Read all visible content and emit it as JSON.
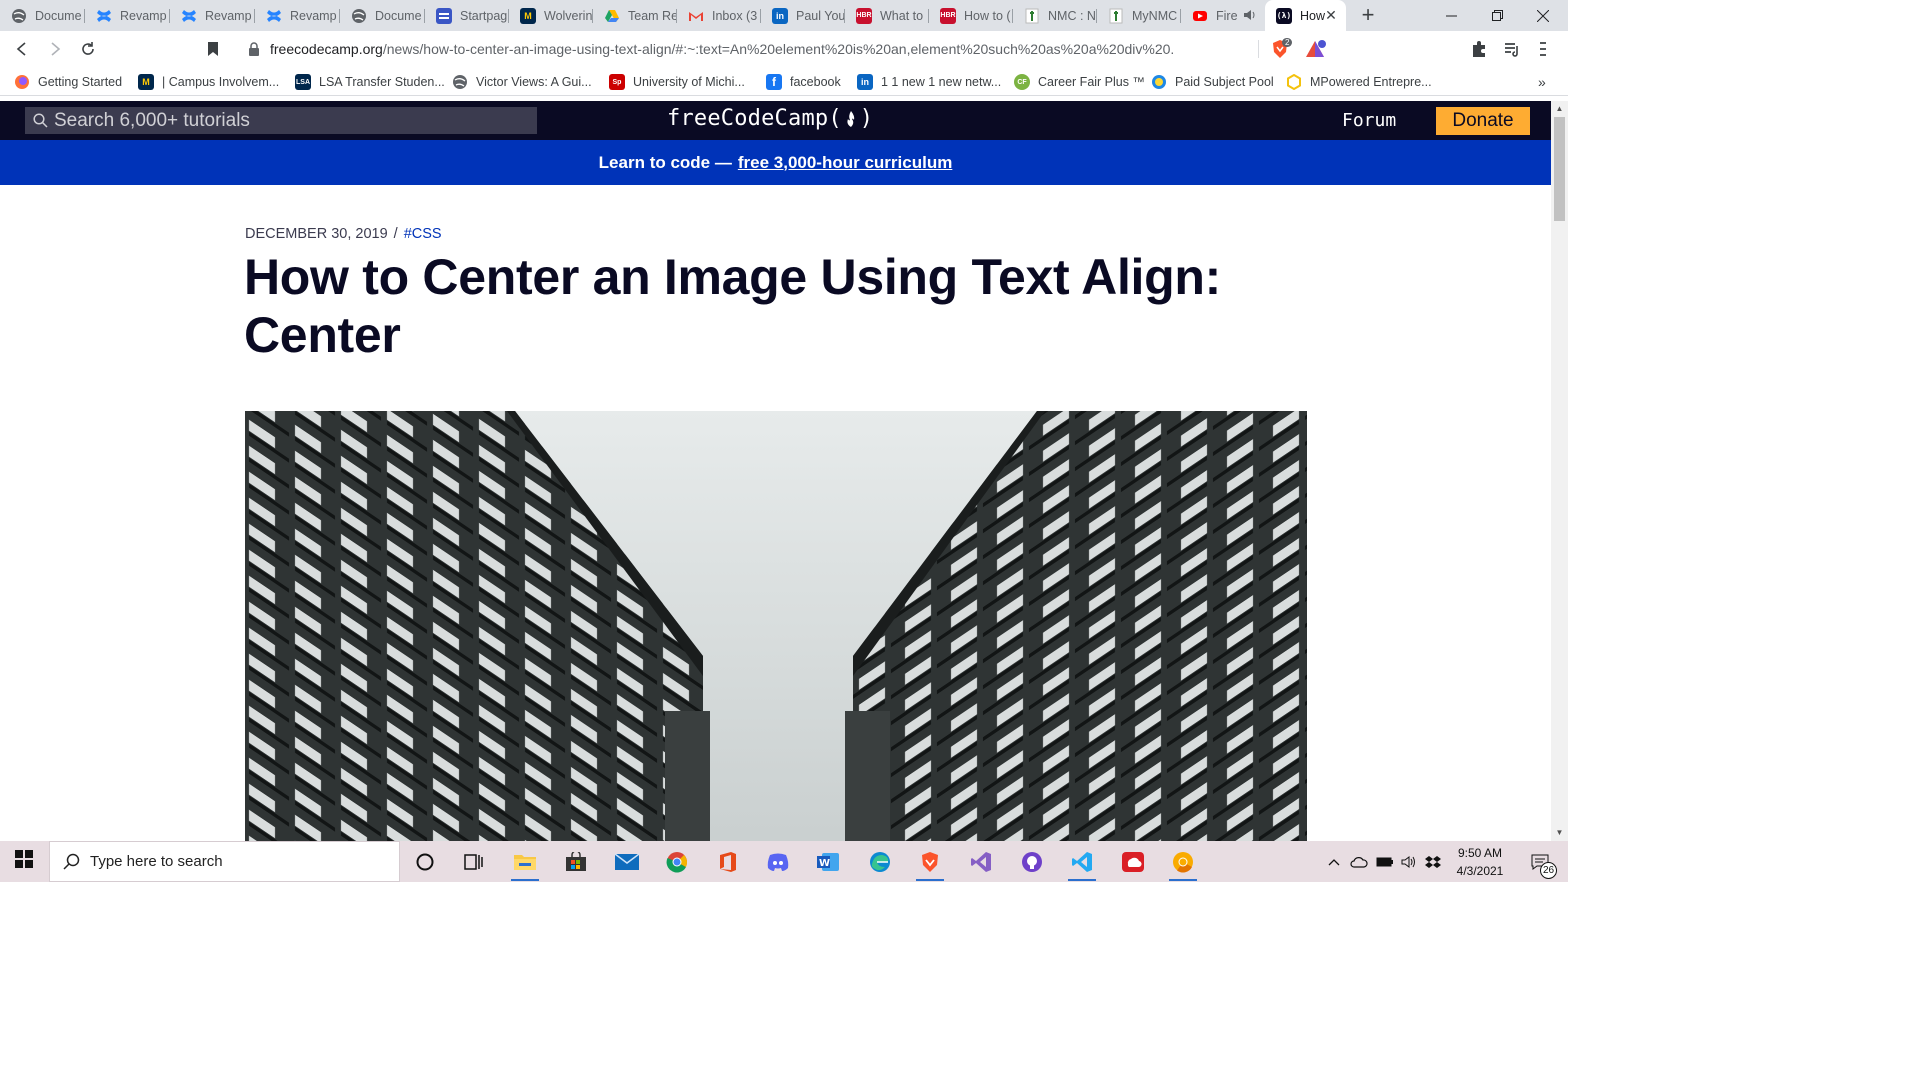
{
  "browser": {
    "tabs": [
      {
        "title": "Docume",
        "icon": "globe-icon",
        "color": "#5f6368"
      },
      {
        "title": "Revamp",
        "icon": "confluence-icon",
        "color": "#2684ff"
      },
      {
        "title": "Revamp",
        "icon": "confluence-icon",
        "color": "#2684ff"
      },
      {
        "title": "Revamp",
        "icon": "confluence-icon",
        "color": "#2684ff"
      },
      {
        "title": "Docume",
        "icon": "globe-icon",
        "color": "#5f6368"
      },
      {
        "title": "Startpag",
        "icon": "startpage-icon",
        "color": "#3a56c5"
      },
      {
        "title": "Wolverin",
        "icon": "umich-icon",
        "color": "#00274c"
      },
      {
        "title": "Team Re",
        "icon": "google-drive-icon",
        "color": "#1fa463"
      },
      {
        "title": "Inbox (3",
        "icon": "gmail-icon",
        "color": "#ea4335"
      },
      {
        "title": "Paul You",
        "icon": "linkedin-icon",
        "color": "#0a66c2"
      },
      {
        "title": "What to",
        "icon": "hbr-icon",
        "color": "#c8102e"
      },
      {
        "title": "How to (",
        "icon": "hbr-icon",
        "color": "#c8102e"
      },
      {
        "title": "NMC : N",
        "icon": "nmc-icon",
        "color": "#2e7d32"
      },
      {
        "title": "MyNMC",
        "icon": "nmc-icon",
        "color": "#2e7d32"
      },
      {
        "title": "Fire",
        "icon": "youtube-icon",
        "color": "#ff0000"
      },
      {
        "title": "How",
        "icon": "freecodecamp-icon",
        "color": "#0a0a23"
      }
    ],
    "active_tab_close": "✕",
    "url_host": "freecodecamp.org",
    "url_path": "/news/how-to-center-an-image-using-text-align/#:~:text=An%20element%20is%20an,element%20such%20as%20a%20div%20.",
    "brave_badge": "2",
    "bookmarks": [
      {
        "label": "Getting Started",
        "icon": "firefox-icon",
        "color": "#ff7139"
      },
      {
        "label": "| Campus Involvem...",
        "icon": "umich-icon",
        "color": "#00274c"
      },
      {
        "label": "LSA Transfer Studen...",
        "icon": "lsa-icon",
        "color": "#00274c"
      },
      {
        "label": "Victor Views: A Gui...",
        "icon": "globe-icon",
        "color": "#5f6368"
      },
      {
        "label": "University of Michi...",
        "icon": "sp-icon",
        "color": "#cc0000"
      },
      {
        "label": "facebook",
        "icon": "facebook-icon",
        "color": "#1877f2"
      },
      {
        "label": "1 1 new 1 new netw...",
        "icon": "linkedin-icon",
        "color": "#0a66c2"
      },
      {
        "label": "Career Fair Plus ™",
        "icon": "cfp-icon",
        "color": "#7cb342"
      },
      {
        "label": "Paid Subject Pool",
        "icon": "pool-icon",
        "color": "#1e88e5"
      },
      {
        "label": "MPowered Entrepre...",
        "icon": "hexagon-icon",
        "color": "#f4c20d"
      }
    ],
    "bookmarks_overflow": "»"
  },
  "page": {
    "search_placeholder": "Search 6,000+ tutorials",
    "logo_text": "freeCodeCamp(",
    "logo_close": ")",
    "forum_label": "Forum",
    "donate_label": "Donate",
    "banner_prefix": "Learn to code —",
    "banner_link": "free 3,000-hour curriculum",
    "date": "DECEMBER 30, 2019",
    "separator": "/",
    "tag": "#CSS",
    "title": "How to Center an Image Using Text Align: Center"
  },
  "taskbar": {
    "search_placeholder": "Type here to search",
    "time": "9:50 AM",
    "date": "4/3/2021",
    "notification_count": "26"
  },
  "colors": {
    "fcc_navy": "#0a0a23",
    "fcc_blue_banner": "#0033b8",
    "donate_yellow": "#feac32"
  }
}
